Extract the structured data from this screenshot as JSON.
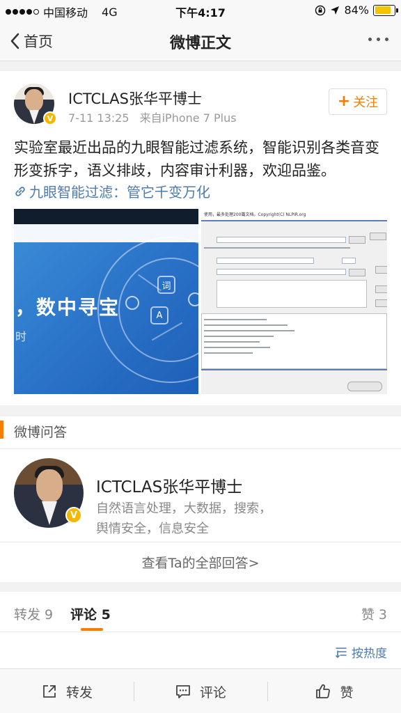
{
  "status_bar": {
    "carrier": "中国移动",
    "network": "4G",
    "time": "下午4:17",
    "battery_percent": "84%",
    "battery_level": 0.84
  },
  "nav": {
    "back_label": "首页",
    "title": "微博正文"
  },
  "post": {
    "author": "ICTCLAS张华平博士",
    "verified_mark": "V",
    "date": "7-11 13:25",
    "source": "来自iPhone 7 Plus",
    "follow_label": "关注",
    "text": "实验室最近出品的九眼智能过滤系统，智能识别各类音变形变拆字，语义排歧，内容审计利器，欢迎品鉴。",
    "link_text": "九眼智能过滤：管它千变万化",
    "image1": {
      "slogan": "，数中寻宝",
      "subtext": "时",
      "icon_text_1": "词",
      "icon_text_2": "A"
    },
    "image2": {
      "header": "使用，最多处理200篇文档。Copyright(C) NLPIR.org"
    }
  },
  "qa": {
    "title": "微博问答",
    "name": "ICTCLAS张华平博士",
    "desc": "自然语言处理，大数据，搜索，舆情安全，信息安全",
    "more_label": "查看Ta的全部回答>"
  },
  "tabs": {
    "repost_label": "转发 9",
    "comment_label": "评论 5",
    "like_label": "赞 3",
    "sort_label": "按热度"
  },
  "toolbar": {
    "repost": "转发",
    "comment": "评论",
    "like": "赞"
  },
  "colors": {
    "accent": "#f57d00",
    "link": "#4f7cad",
    "verified": "#f6b700"
  }
}
